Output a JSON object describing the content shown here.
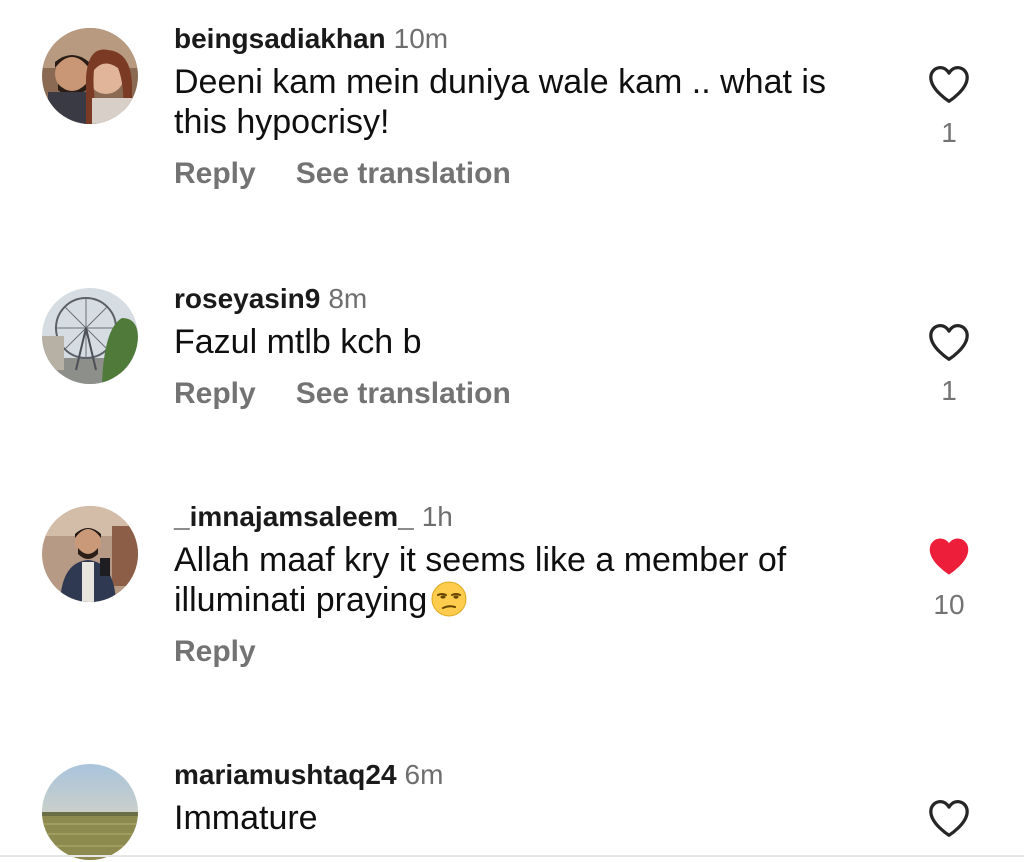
{
  "actions": {
    "reply_label": "Reply",
    "translate_label": "See translation"
  },
  "colors": {
    "liked_heart": "#ed1e3a",
    "muted_text": "#737373",
    "unliked_heart_stroke": "#262626"
  },
  "comments": [
    {
      "username": "beingsadiakhan",
      "time": "10m",
      "text": "Deeni kam mein duniya wale kam .. what is this hypocrisy!",
      "likes": "1",
      "liked": false,
      "avatar_icon": "couple-photo-avatar",
      "show_translation": true
    },
    {
      "username": "roseyasin9",
      "time": "8m",
      "text": "Fazul mtlb kch b",
      "likes": "1",
      "liked": false,
      "avatar_icon": "ferris-wheel-photo-avatar",
      "show_translation": true
    },
    {
      "username": "_imnajamsaleem_",
      "time": "1h",
      "text": "Allah maaf kry it seems like a member of illuminati praying",
      "emoji": "unamused-face-emoji",
      "likes": "10",
      "liked": true,
      "avatar_icon": "man-photo-avatar",
      "show_translation": false
    },
    {
      "username": "mariamushtaq24",
      "time": "6m",
      "text": "Immature",
      "likes": "",
      "liked": false,
      "avatar_icon": "field-landscape-avatar",
      "show_translation": false
    }
  ]
}
